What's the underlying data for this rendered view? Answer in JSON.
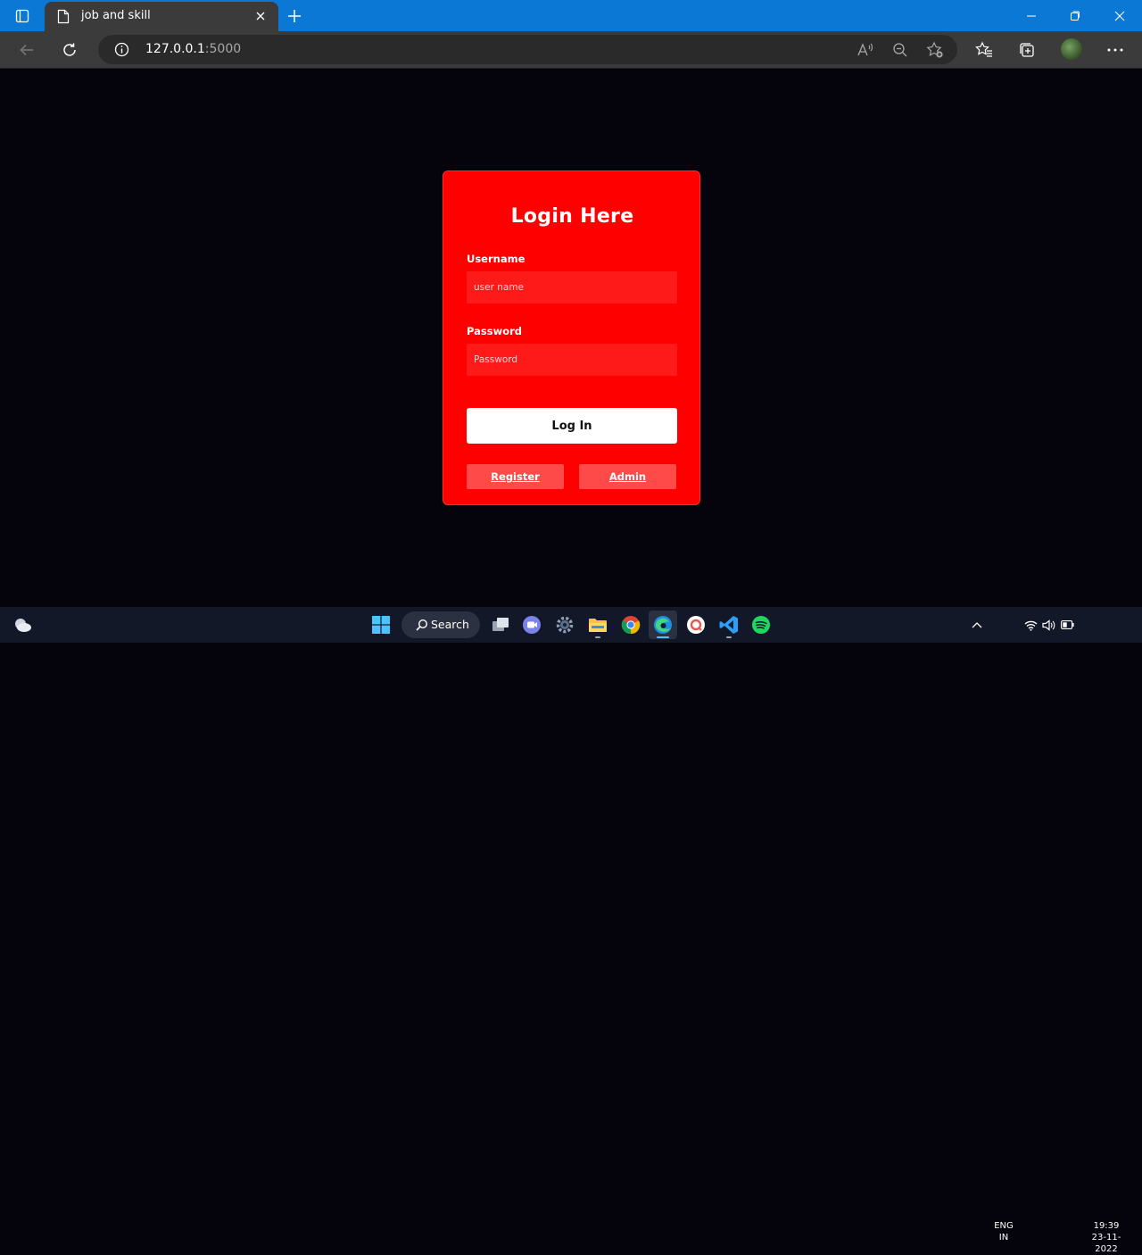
{
  "browser": {
    "tab_title": "job and skill",
    "url_host": "127.0.0.1",
    "url_port": ":5000"
  },
  "login": {
    "title": "Login Here",
    "username_label": "Username",
    "username_placeholder": "user name",
    "password_label": "Password",
    "password_placeholder": "Password",
    "login_button": "Log In",
    "register_link": "Register",
    "admin_link": "Admin",
    "colors": {
      "card": "#ff0000",
      "input": "#ff1a1a",
      "link_button": "#ff4a4a",
      "page_bg": "#05040c"
    }
  },
  "taskbar": {
    "search_label": "Search",
    "language_top": "ENG",
    "language_bottom": "IN",
    "time": "19:39",
    "date": "23-11-2022"
  }
}
